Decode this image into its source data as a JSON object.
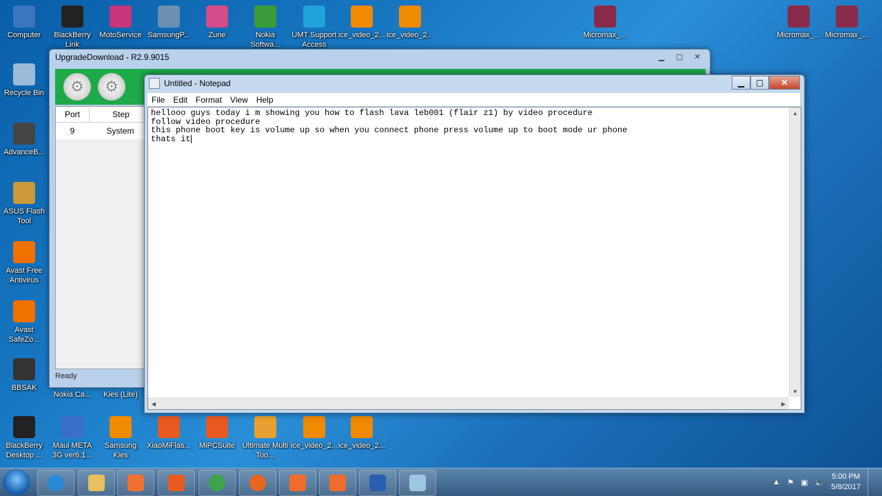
{
  "desktop": {
    "icons_top": [
      {
        "label": "Computer",
        "color": "#3a76c0"
      },
      {
        "label": "BlackBerry Link",
        "color": "#222222"
      },
      {
        "label": "MotoService",
        "color": "#c8347c"
      },
      {
        "label": "SamsungP...",
        "color": "#6a8fb0"
      },
      {
        "label": "Zune",
        "color": "#d64b8a"
      },
      {
        "label": "Nokia Softwa...",
        "color": "#3a9d3a"
      },
      {
        "label": "UMT Support Access",
        "color": "#22a2d8"
      },
      {
        "label": "ice_video_2...",
        "color": "#f08a00"
      },
      {
        "label": "ice_video_2...",
        "color": "#f08a00"
      },
      {
        "label": "Micromax_...",
        "color": "#8a2a4a"
      },
      {
        "label": "Micromax_...",
        "color": "#8a2a4a"
      },
      {
        "label": "Micromax_...",
        "color": "#8a2a4a"
      }
    ],
    "icons_left": [
      {
        "label": "Recycle Bin",
        "color": "#9bbbd8"
      },
      {
        "label": "AdvanceB...",
        "color": "#444444"
      },
      {
        "label": "ASUS Flash Tool",
        "color": "#c89a3a"
      },
      {
        "label": "Avast Free Antivirus",
        "color": "#f07000"
      },
      {
        "label": "Avast SafeZo...",
        "color": "#f07000"
      },
      {
        "label": "BBSAK",
        "color": "#333333"
      }
    ],
    "icons_bottom": [
      {
        "label": "BlackBerry Desktop ...",
        "color": "#222222"
      },
      {
        "label": "Maui META 3G ver6.1...",
        "color": "#3a6ec8"
      },
      {
        "label": "Samsung Kies",
        "color": "#f08a00"
      },
      {
        "label": "XiaoMiFlas...",
        "color": "#e85a20"
      },
      {
        "label": "MiPCSuite",
        "color": "#e85a20"
      },
      {
        "label": "Ultimate Multi Too...",
        "color": "#e8a030"
      },
      {
        "label": "ice_video_2...",
        "color": "#f08a00"
      },
      {
        "label": "ice_video_2...",
        "color": "#f08a00"
      }
    ],
    "partial_labels": [
      "Nokia Ca...",
      "Kies (Lite)"
    ]
  },
  "upgrade_window": {
    "title": "UpgradeDownload - R2.9.9015",
    "columns": [
      "Port",
      "Step"
    ],
    "rows": [
      {
        "port": "9",
        "step": "System"
      }
    ],
    "status": "Ready"
  },
  "notepad": {
    "title": "Untitled - Notepad",
    "menu": [
      "File",
      "Edit",
      "Format",
      "View",
      "Help"
    ],
    "lines": [
      "hellooo guys today i m showing you how to flash lava leb001 (flair z1) by video procedure",
      "follow video procedure",
      "this phone boot key is volume up so when you connect phone press volume up to boot mode ur phone",
      "thats it"
    ]
  },
  "taskbar": {
    "items": [
      {
        "name": "internet-explorer",
        "color": "#2a8ad8"
      },
      {
        "name": "file-explorer",
        "color": "#e8c060"
      },
      {
        "name": "media-player",
        "color": "#f07030"
      },
      {
        "name": "mi-app",
        "color": "#e85a20"
      },
      {
        "name": "chrome",
        "color": "#3fa34d"
      },
      {
        "name": "firefox",
        "color": "#e8661e"
      },
      {
        "name": "orange-app-1",
        "color": "#ef6c2c"
      },
      {
        "name": "orange-app-2",
        "color": "#ef6c2c"
      },
      {
        "name": "upgrade-download",
        "color": "#2a5fb0"
      },
      {
        "name": "notepad",
        "color": "#9ec6e0"
      }
    ],
    "time": "5:00 PM",
    "date": "5/8/2017"
  }
}
